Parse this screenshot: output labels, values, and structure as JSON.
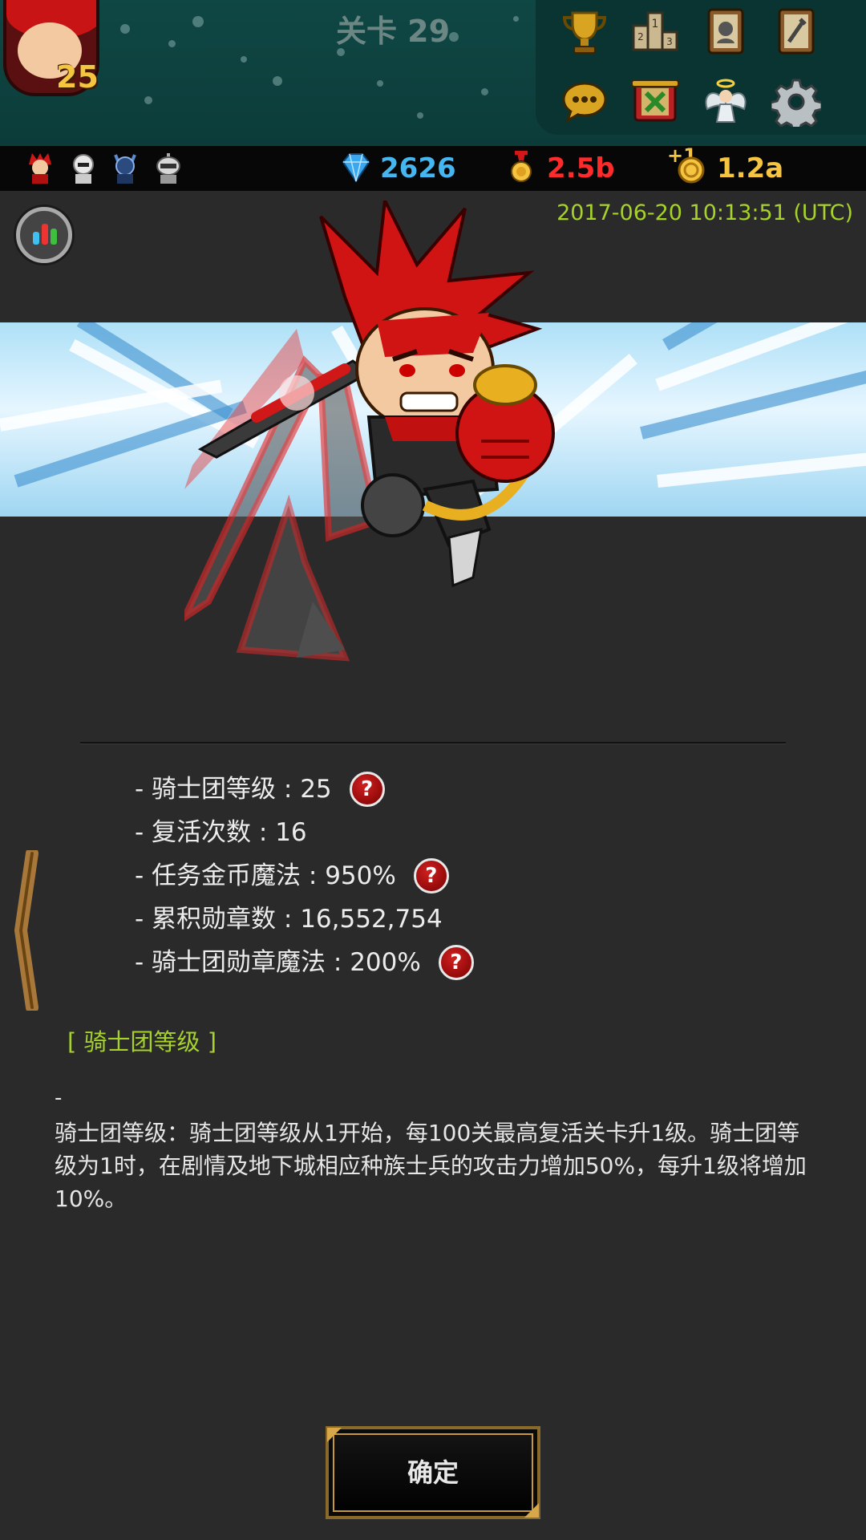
{
  "header": {
    "stage_title": "关卡 29",
    "avatar_level": "25",
    "menu_icons": [
      "trophy-icon",
      "podium-icon",
      "hero-book-icon",
      "skill-book-icon",
      "chat-icon",
      "quest-scroll-icon",
      "angel-icon",
      "gear-icon"
    ]
  },
  "resources": {
    "mini_heroes": [
      "red-hero-icon",
      "white-hero-icon",
      "blue-knight-icon",
      "robot-hero-icon"
    ],
    "gems": "2626",
    "medals": "2.5b",
    "gold_prefix": "+1",
    "gold": "1.2a",
    "colors": {
      "gems": "#45b6f0",
      "medals": "#ff2a2a",
      "gold": "#f5c542"
    }
  },
  "panel": {
    "timestamp": "2017-06-20 10:13:51 (UTC)",
    "stats": [
      {
        "text": "- 骑士团等级 : 25",
        "help": true
      },
      {
        "text": "- 复活次数 : 16",
        "help": false
      },
      {
        "text": "- 任务金币魔法 : 950%",
        "help": true
      },
      {
        "text": "- 累积勋章数 : 16,552,754",
        "help": false
      },
      {
        "text": "- 骑士团勋章魔法 : 200%",
        "help": true
      }
    ],
    "help_symbol": "?",
    "section_title": "[ 骑士团等级 ]",
    "desc_dash": "-",
    "description": "骑士团等级：骑士团等级从1开始，每100关最高复活关卡升1级。骑士团等级为1时，在剧情及地下城相应种族士兵的攻击力增加50%，每升1级将增加10%。",
    "confirm_label": "确定"
  }
}
